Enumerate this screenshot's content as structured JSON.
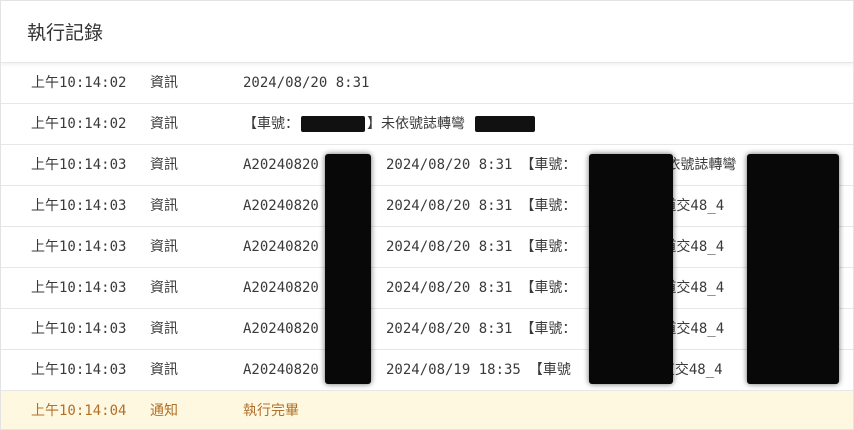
{
  "header": {
    "title": "執行記錄"
  },
  "rows": [
    {
      "time": "上午10:14:02",
      "level": "資訊",
      "message": "2024/08/20 8:31"
    },
    {
      "time": "上午10:14:02",
      "level": "資訊",
      "prefix": "【車號：",
      "suffix": "】未依號誌轉彎"
    },
    {
      "time": "上午10:14:03",
      "level": "資訊",
      "id": "A20240820",
      "date": "2024/08/20 8:31",
      "tail": "【車號：",
      "tail2": "未依號誌轉彎"
    },
    {
      "time": "上午10:14:03",
      "level": "資訊",
      "id": "A20240820",
      "date": "2024/08/20 8:31",
      "tail": "【車號：",
      "tail2": "道交48_4"
    },
    {
      "time": "上午10:14:03",
      "level": "資訊",
      "id": "A20240820",
      "date": "2024/08/20 8:31",
      "tail": "【車號：",
      "tail2": "道交48_4"
    },
    {
      "time": "上午10:14:03",
      "level": "資訊",
      "id": "A20240820",
      "date": "2024/08/20 8:31",
      "tail": "【車號：",
      "tail2": "道交48_4"
    },
    {
      "time": "上午10:14:03",
      "level": "資訊",
      "id": "A20240820",
      "date": "2024/08/20 8:31",
      "tail": "【車號：",
      "tail2": "道交48_4"
    },
    {
      "time": "上午10:14:03",
      "level": "資訊",
      "id": "A20240820",
      "date": "2024/08/19 18:35",
      "tail": "【車號",
      "tail2": "道交48_4"
    },
    {
      "time": "上午10:14:04",
      "level": "通知",
      "message": "執行完畢"
    }
  ],
  "colors": {
    "notice_background": "#fff8e1",
    "notice_text": "#b0702a",
    "redaction": "#080808"
  }
}
